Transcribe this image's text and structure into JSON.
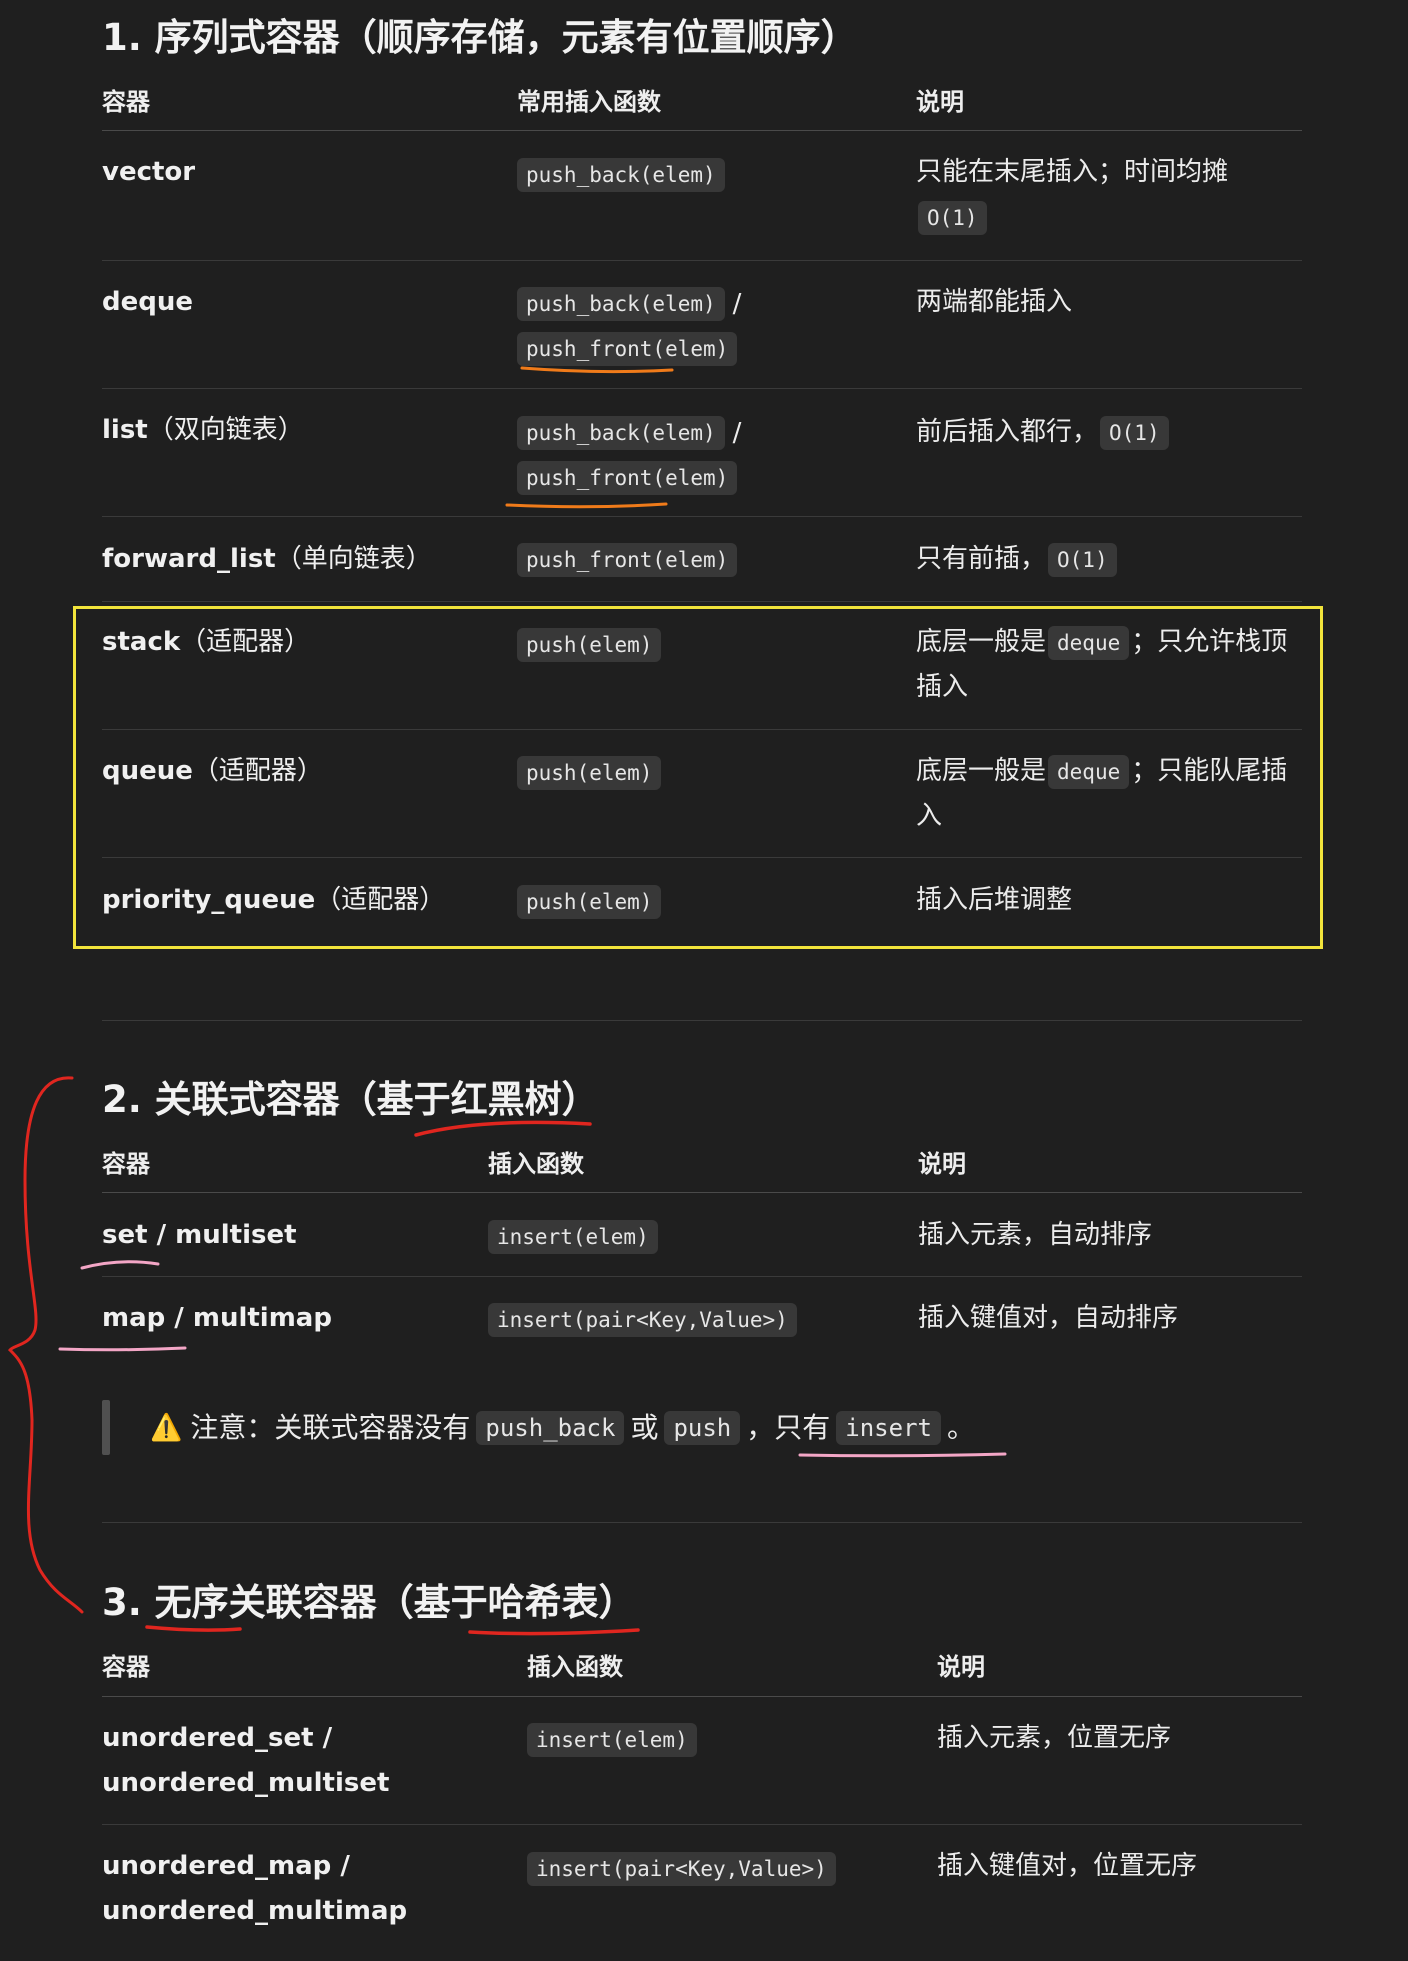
{
  "section1": {
    "title": "1. 序列式容器（顺序存储，元素有位置顺序）",
    "headers": [
      "容器",
      "常用插入函数",
      "说明"
    ],
    "rows": [
      {
        "name": "vector",
        "note": "",
        "funcs": [
          "push_back(elem)"
        ],
        "desc_parts": [
          "只能在末尾插入；时间均摊",
          "",
          ""
        ],
        "desc_code": "O(1)"
      },
      {
        "name": "deque",
        "note": "",
        "funcs": [
          "push_back(elem)",
          "push_front(elem)"
        ],
        "desc": "两端都能插入"
      },
      {
        "name": "list",
        "note": "（双向链表）",
        "funcs": [
          "push_back(elem)",
          "push_front(elem)"
        ],
        "desc": "前后插入都行，",
        "desc_code": "O(1)"
      },
      {
        "name": "forward_list",
        "note": "（单向链表）",
        "funcs": [
          "push_front(elem)"
        ],
        "desc": "只有前插，",
        "desc_code": "O(1)"
      },
      {
        "name": "stack",
        "note": "（适配器）",
        "funcs": [
          "push(elem)"
        ],
        "desc_pre": "底层一般是",
        "desc_code": "deque",
        "desc_post": "；只允许栈顶",
        "desc_line2": "插入"
      },
      {
        "name": "queue",
        "note": "（适配器）",
        "funcs": [
          "push(elem)"
        ],
        "desc_pre": "底层一般是",
        "desc_code": "deque",
        "desc_post": "；只能队尾插",
        "desc_line2": "入"
      },
      {
        "name": "priority_queue",
        "note": "（适配器）",
        "funcs": [
          "push(elem)"
        ],
        "desc": "插入后堆调整"
      }
    ],
    "slash": "/"
  },
  "section2": {
    "title": "2. 关联式容器（基于红黑树）",
    "headers": [
      "容器",
      "插入函数",
      "说明"
    ],
    "rows": [
      {
        "name": "set / multiset",
        "func": "insert(elem)",
        "desc": "插入元素，自动排序"
      },
      {
        "name": "map / multimap",
        "func": "insert(pair<Key,Value>)",
        "desc": "插入键值对，自动排序"
      }
    ],
    "notice": {
      "icon": "⚠️",
      "pre": "注意：关联式容器没有",
      "code1": "push_back",
      "mid": "或",
      "code2": "push",
      "sep": "，",
      "post": "只有",
      "code3": "insert",
      "end": "。"
    }
  },
  "section3": {
    "title": "3. 无序关联容器（基于哈希表）",
    "headers": [
      "容器",
      "插入函数",
      "说明"
    ],
    "rows": [
      {
        "name_line1": "unordered_set /",
        "name_line2": "unordered_multiset",
        "func": "insert(elem)",
        "desc": "插入元素，位置无序"
      },
      {
        "name_line1": "unordered_map /",
        "name_line2": "unordered_multimap",
        "func": "insert(pair<Key,Value>)",
        "desc": "插入键值对，位置无序"
      }
    ]
  },
  "colors": {
    "background": "#1f1f1f",
    "highlight_box": "#f2e43b",
    "red_annotation": "#e0261f",
    "pink_underline": "#f3a6c6",
    "orange_underline": "#f07b1a",
    "warning_icon": "#f6b21b"
  }
}
